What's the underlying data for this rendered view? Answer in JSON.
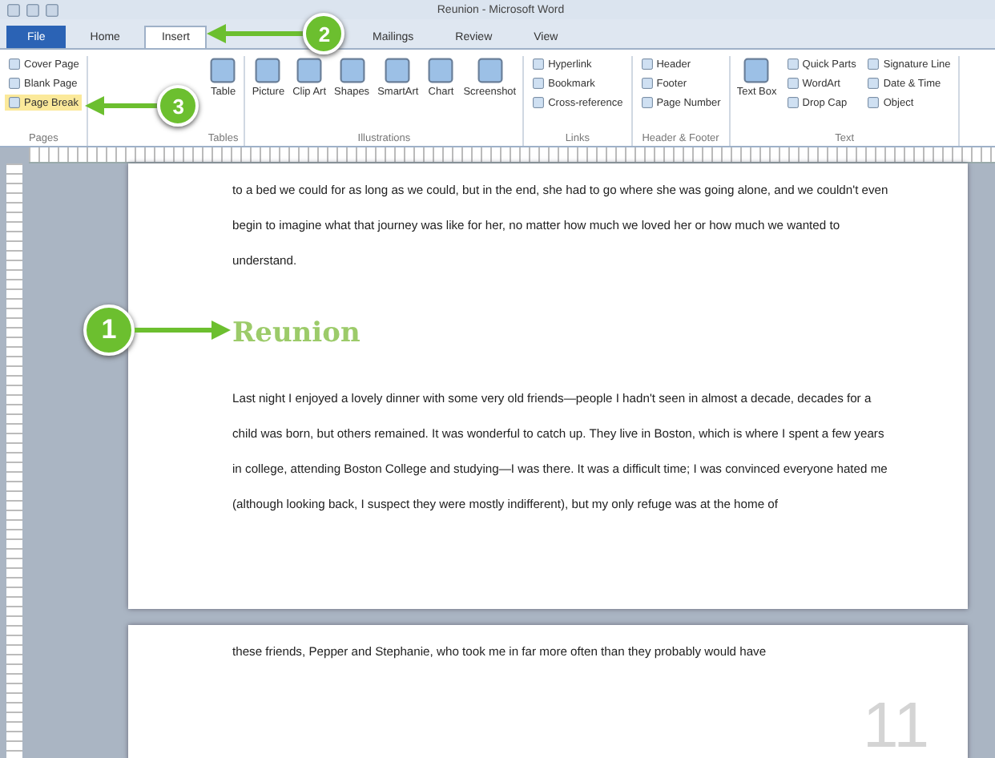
{
  "window": {
    "title": "Reunion - Microsoft Word"
  },
  "tabs": [
    {
      "label": "File",
      "kind": "file",
      "selected": false
    },
    {
      "label": "Home",
      "kind": "tab",
      "selected": false
    },
    {
      "label": "Insert",
      "kind": "tab",
      "selected": true
    },
    {
      "label": "Mailings",
      "kind": "tab",
      "selected": false
    },
    {
      "label": "Review",
      "kind": "tab",
      "selected": false
    },
    {
      "label": "View",
      "kind": "tab",
      "selected": false
    }
  ],
  "ribbon_groups": [
    {
      "name": "Pages",
      "items": [
        {
          "label": "Cover Page",
          "kind": "small",
          "selected": false
        },
        {
          "label": "Blank Page",
          "kind": "small",
          "selected": false
        },
        {
          "label": "Page Break",
          "kind": "small",
          "selected": true
        }
      ]
    },
    {
      "name": "Tables",
      "items": [
        {
          "label": "Table",
          "kind": "large",
          "selected": false
        }
      ]
    },
    {
      "name": "Illustrations",
      "items": [
        {
          "label": "Picture",
          "kind": "large",
          "selected": false
        },
        {
          "label": "Clip Art",
          "kind": "large",
          "selected": false
        },
        {
          "label": "Shapes",
          "kind": "large",
          "selected": false
        },
        {
          "label": "SmartArt",
          "kind": "large",
          "selected": false
        },
        {
          "label": "Chart",
          "kind": "large",
          "selected": false
        },
        {
          "label": "Screenshot",
          "kind": "large",
          "selected": false
        }
      ]
    },
    {
      "name": "Links",
      "items": [
        {
          "label": "Hyperlink",
          "kind": "small",
          "selected": false
        },
        {
          "label": "Bookmark",
          "kind": "small",
          "selected": false
        },
        {
          "label": "Cross-reference",
          "kind": "small",
          "selected": false
        }
      ]
    },
    {
      "name": "Header & Footer",
      "items": [
        {
          "label": "Header",
          "kind": "small",
          "selected": false
        },
        {
          "label": "Footer",
          "kind": "small",
          "selected": false
        },
        {
          "label": "Page Number",
          "kind": "small",
          "selected": false
        }
      ]
    },
    {
      "name": "Text",
      "items": [
        {
          "label": "Text Box",
          "kind": "large",
          "selected": false
        },
        {
          "label": "Quick Parts",
          "kind": "small",
          "selected": false
        },
        {
          "label": "WordArt",
          "kind": "small",
          "selected": false
        },
        {
          "label": "Drop Cap",
          "kind": "small",
          "selected": false
        },
        {
          "label": "Signature Line",
          "kind": "small",
          "selected": false
        },
        {
          "label": "Date & Time",
          "kind": "small",
          "selected": false
        },
        {
          "label": "Object",
          "kind": "small",
          "selected": false
        }
      ]
    }
  ],
  "pages": [
    {
      "blocks": [
        {
          "kind": "body",
          "text": "to a bed we could for as long as we could, but in the end, she had to go where she was going alone, and we couldn't even begin to imagine what that journey was like for her, no matter how much we loved her or how much we wanted to understand."
        },
        {
          "kind": "heading",
          "text": "Reunion"
        },
        {
          "kind": "body",
          "text": "Last night I enjoyed a lovely dinner with some very old friends—people I hadn't seen in almost a decade, decades for a child was born, but others remained. It was wonderful to catch up. They live in Boston, which is where I spent a few years in college, attending Boston College and studying—I was there. It was a difficult time; I was convinced everyone hated me (although looking back, I suspect they were mostly indifferent), but my only refuge was at the home of"
        }
      ]
    },
    {
      "blocks": [
        {
          "kind": "body",
          "text": "these friends, Pepper and Stephanie, who took me in far more often than they probably would have"
        }
      ],
      "page_number": "11"
    }
  ],
  "callouts": [
    {
      "number": "1"
    },
    {
      "number": "2"
    },
    {
      "number": "3"
    }
  ]
}
